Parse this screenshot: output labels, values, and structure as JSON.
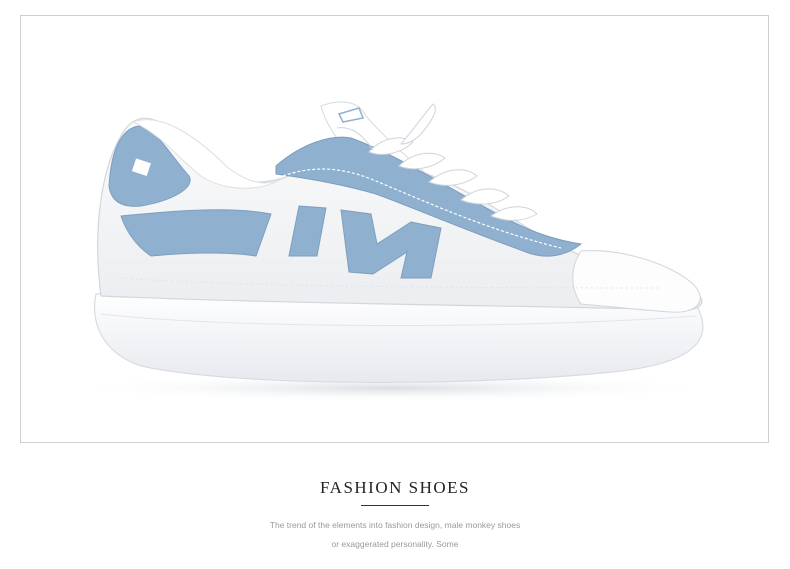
{
  "product": {
    "image_subject": "white leather sneaker with light blue suede accents and white laces",
    "colors": {
      "accent_blue": "#8fb0cf",
      "upper_white": "#f6f6f6",
      "sole_white": "#ffffff"
    }
  },
  "heading": {
    "title": "FASHION SHOES"
  },
  "caption": {
    "line1": "The trend of the elements into fashion design, male  monkey shoes",
    "line2": "or exaggerated personality. Some"
  }
}
